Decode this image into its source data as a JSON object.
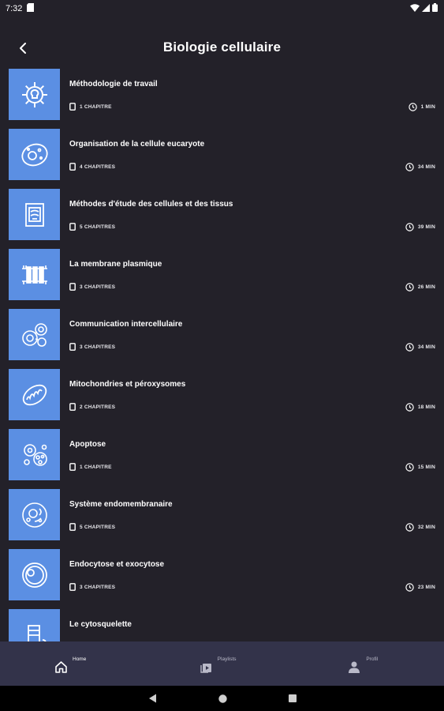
{
  "status_bar": {
    "time": "7:32"
  },
  "header": {
    "title": "Biologie cellulaire"
  },
  "courses": [
    {
      "title": "Méthodologie de travail",
      "chapters": "1 CHAPITRE",
      "duration": "1 MIN",
      "icon": "gear-lightbulb-icon"
    },
    {
      "title": "Organisation de la cellule eucaryote",
      "chapters": "4 CHAPITRES",
      "duration": "34 MIN",
      "icon": "cell-icon"
    },
    {
      "title": "Méthodes d'étude des cellules et des tissus",
      "chapters": "5 CHAPITRES",
      "duration": "39 MIN",
      "icon": "microscope-slide-icon"
    },
    {
      "title": "La membrane plasmique",
      "chapters": "3 CHAPITRES",
      "duration": "26 MIN",
      "icon": "membrane-icon"
    },
    {
      "title": "Communication intercellulaire",
      "chapters": "3 CHAPITRES",
      "duration": "34 MIN",
      "icon": "cell-communication-icon"
    },
    {
      "title": "Mitochondries et péroxysomes",
      "chapters": "2 CHAPITRES",
      "duration": "18 MIN",
      "icon": "mitochondria-icon"
    },
    {
      "title": "Apoptose",
      "chapters": "1 CHAPITRE",
      "duration": "15 MIN",
      "icon": "apoptosis-icon"
    },
    {
      "title": "Système endomembranaire",
      "chapters": "5 CHAPITRES",
      "duration": "32 MIN",
      "icon": "endomembrane-icon"
    },
    {
      "title": "Endocytose et exocytose",
      "chapters": "3 CHAPITRES",
      "duration": "23 MIN",
      "icon": "endocytosis-icon"
    },
    {
      "title": "Le cytosquelette",
      "chapters": "",
      "duration": "",
      "icon": "cytoskeleton-icon"
    }
  ],
  "bottom_nav": {
    "items": [
      {
        "label": "Home",
        "icon": "home-icon",
        "active": true
      },
      {
        "label": "Playlists",
        "icon": "playlist-icon",
        "active": false
      },
      {
        "label": "Profil",
        "icon": "profile-icon",
        "active": false
      }
    ]
  },
  "colors": {
    "background": "#232129",
    "thumbnail": "#5b8fe3",
    "nav": "#33334a"
  }
}
